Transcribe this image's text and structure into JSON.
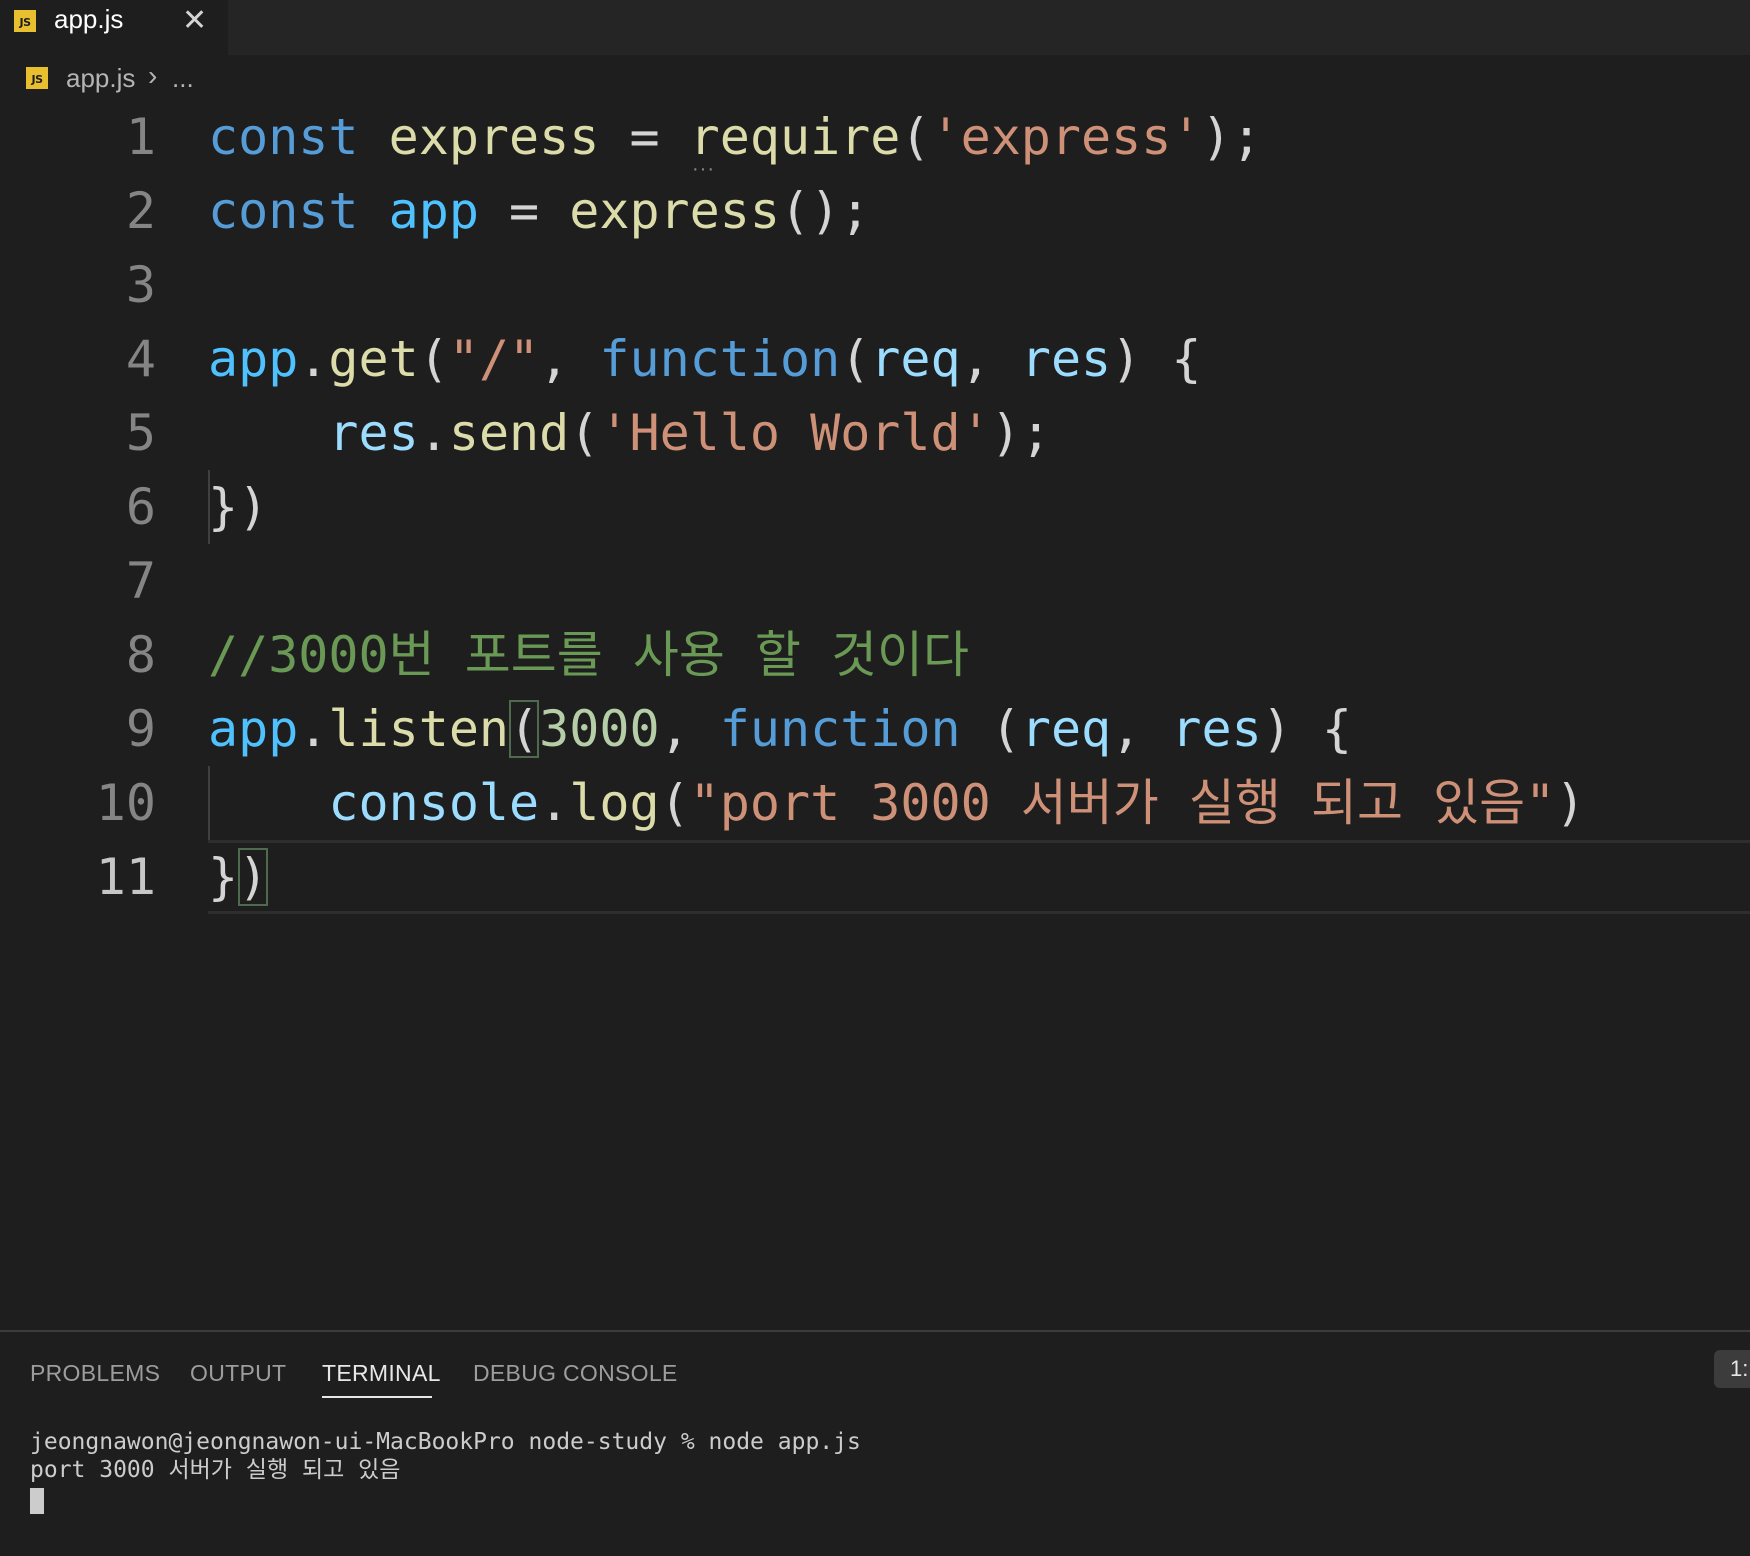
{
  "tabs": [
    {
      "icon": "js-file-icon",
      "icon_text": "JS",
      "label": "app.js"
    }
  ],
  "breadcrumb": {
    "icon_text": "JS",
    "file": "app.js",
    "more": "..."
  },
  "editor": {
    "line_numbers": [
      "1",
      "2",
      "3",
      "4",
      "5",
      "6",
      "7",
      "8",
      "9",
      "10",
      "11"
    ],
    "active_line": "11"
  },
  "code": {
    "l1": {
      "kw": "const",
      "var": "express",
      "op": " = ",
      "fn": "require",
      "p1": "(",
      "str": "'express'",
      "p2": ");"
    },
    "l2": {
      "kw": "const",
      "var": "app",
      "op": " = ",
      "fn": "express",
      "p": "();"
    },
    "l4": {
      "var": "app",
      "dot": ".",
      "fn": "get",
      "p1": "(",
      "str": "\"/\"",
      "comma": ", ",
      "kw": "function",
      "p2": "(",
      "a1": "req",
      "comma2": ", ",
      "a2": "res",
      "p3": ") {"
    },
    "l5": {
      "indent": "    ",
      "obj": "res",
      "dot": ".",
      "fn": "send",
      "p1": "(",
      "str": "'Hello World'",
      "p2": ");"
    },
    "l6": {
      "text": "})"
    },
    "l8": {
      "comment": "//3000번 포트를 사용 할 것이다"
    },
    "l9": {
      "var": "app",
      "dot": ".",
      "fn": "listen",
      "p1": "(",
      "num": "3000",
      "comma": ", ",
      "kw": "function",
      "sp": " (",
      "a1": "req",
      "comma2": ", ",
      "a2": "res",
      "p2": ") {"
    },
    "l10": {
      "indent": "    ",
      "obj": "console",
      "dot": ".",
      "fn": "log",
      "p1": "(",
      "str": "\"port 3000 서버가 실행 되고 있음\"",
      "p2": ")"
    },
    "l11": {
      "b1": "}",
      "b2": ")"
    }
  },
  "panel": {
    "tabs": [
      "PROBLEMS",
      "OUTPUT",
      "TERMINAL",
      "DEBUG CONSOLE"
    ],
    "active_tab": "TERMINAL",
    "terminal_selector": "1:",
    "terminal_lines": [
      "jeongnawon@jeongnawon-ui-MacBookPro node-study % node app.js",
      "port 3000 서버가 실행 되고 있음"
    ]
  },
  "colors": {
    "keyword": "#569cd6",
    "function": "#dcdcaa",
    "variable": "#4fc1ff",
    "parameter": "#9cdcfe",
    "string": "#ce9178",
    "number": "#b5cea8",
    "comment": "#6a9955",
    "js_icon": "#e8c02f",
    "background": "#1e1e1e"
  }
}
